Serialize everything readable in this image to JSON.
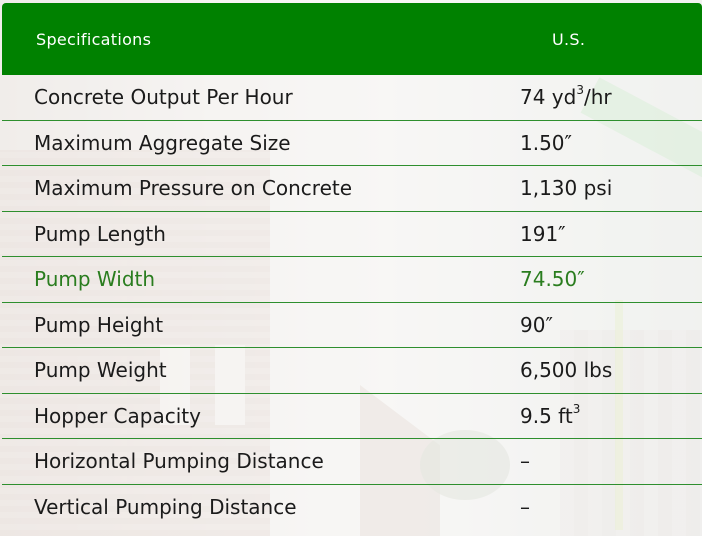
{
  "header": {
    "col1": "Specifications",
    "col2": "U.S."
  },
  "rows": [
    {
      "label": "Concrete Output Per Hour",
      "value": "74 yd",
      "sup": "3",
      "suffix": "/hr"
    },
    {
      "label": "Maximum Aggregate Size",
      "value": "1.50″",
      "sup": "",
      "suffix": ""
    },
    {
      "label": "Maximum Pressure on Concrete",
      "value": "1,130 psi",
      "sup": "",
      "suffix": ""
    },
    {
      "label": "Pump Length",
      "value": "191″",
      "sup": "",
      "suffix": ""
    },
    {
      "label": "Pump Width",
      "value": "74.50″",
      "sup": "",
      "suffix": ""
    },
    {
      "label": "Pump Height",
      "value": "90″",
      "sup": "",
      "suffix": ""
    },
    {
      "label": "Pump Weight",
      "value": "6,500 lbs",
      "sup": "",
      "suffix": ""
    },
    {
      "label": "Hopper Capacity",
      "value": "9.5 ft",
      "sup": "3",
      "suffix": ""
    },
    {
      "label": "Horizontal Pumping Distance",
      "value": "–",
      "sup": "",
      "suffix": ""
    },
    {
      "label": "Vertical Pumping Distance",
      "value": "–",
      "sup": "",
      "suffix": ""
    }
  ],
  "colors": {
    "header_bg": "#008100",
    "row_divider": "#2e8f2e",
    "highlight_text": "#2a7d1f"
  }
}
